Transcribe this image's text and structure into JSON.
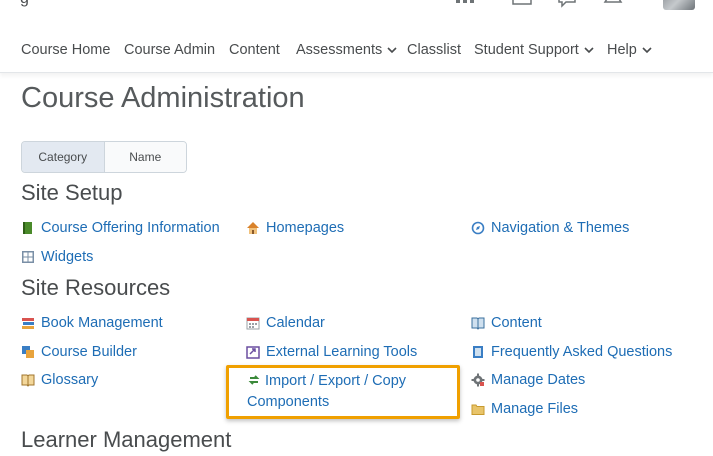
{
  "topbar": {
    "title_fragment": "g",
    "icons": [
      "grid-icon",
      "mail-icon",
      "message-icon",
      "bell-icon",
      "avatar"
    ]
  },
  "nav": {
    "items": [
      {
        "label": "Course Home"
      },
      {
        "label": "Course Admin"
      },
      {
        "label": "Content"
      },
      {
        "label": "Assessments",
        "dropdown": true
      },
      {
        "label": "Classlist"
      },
      {
        "label": "Student Support",
        "dropdown": true
      },
      {
        "label": "Help",
        "dropdown": true
      }
    ]
  },
  "page": {
    "title": "Course Administration"
  },
  "view_toggle": {
    "category": "Category",
    "name": "Name",
    "selected": "Category"
  },
  "sections": {
    "site_setup": {
      "title": "Site Setup",
      "links": [
        {
          "label": "Course Offering Information",
          "icon": "book-green-icon"
        },
        {
          "label": "Homepages",
          "icon": "house-icon"
        },
        {
          "label": "Navigation & Themes",
          "icon": "compass-icon"
        },
        {
          "label": "Widgets",
          "icon": "widget-grid-icon"
        }
      ]
    },
    "site_resources": {
      "title": "Site Resources",
      "links": [
        {
          "label": "Book Management",
          "icon": "book-stack-icon"
        },
        {
          "label": "Calendar",
          "icon": "calendar-icon"
        },
        {
          "label": "Content",
          "icon": "open-book-icon"
        },
        {
          "label": "Course Builder",
          "icon": "builder-icon"
        },
        {
          "label": "External Learning Tools",
          "icon": "external-tool-icon"
        },
        {
          "label": "Frequently Asked Questions",
          "icon": "faq-icon"
        },
        {
          "label": "Glossary",
          "icon": "glossary-icon"
        },
        {
          "label": "Import / Export / Copy Components",
          "icon": "import-export-icon",
          "highlighted": true
        },
        {
          "label": "Manage Dates",
          "icon": "gear-icon"
        },
        {
          "label": "Manage Files",
          "icon": "folder-icon"
        }
      ]
    },
    "learner_management": {
      "title": "Learner Management"
    }
  },
  "colors": {
    "link": "#1e6db5",
    "highlight_border": "#f0a000",
    "text": "#494c4e",
    "toggle_active": "#e3e9f1"
  }
}
